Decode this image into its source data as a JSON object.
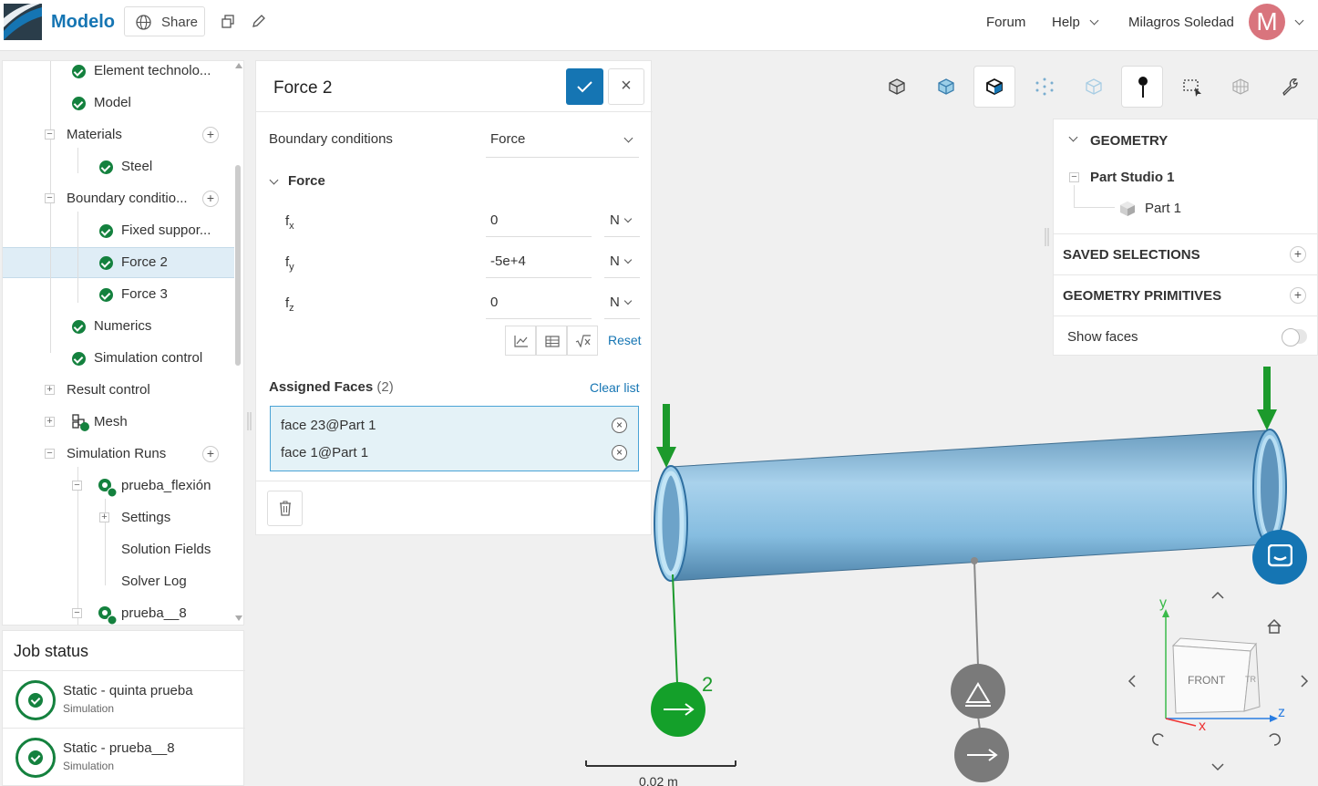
{
  "topbar": {
    "brand": "Modelo",
    "share_label": "Share",
    "forum_label": "Forum",
    "help_label": "Help",
    "user_name": "Milagros Soledad",
    "avatar_initial": "M"
  },
  "tree": {
    "items": [
      {
        "label": "Element technolo...",
        "status": "valid"
      },
      {
        "label": "Model",
        "status": "valid"
      },
      {
        "label": "Materials"
      },
      {
        "label": "Steel",
        "status": "valid"
      },
      {
        "label": "Boundary conditio..."
      },
      {
        "label": "Fixed suppor...",
        "status": "valid"
      },
      {
        "label": "Force 2",
        "status": "valid",
        "selected": true
      },
      {
        "label": "Force 3",
        "status": "valid"
      },
      {
        "label": "Numerics",
        "status": "valid"
      },
      {
        "label": "Simulation control",
        "status": "valid"
      },
      {
        "label": "Result control"
      },
      {
        "label": "Mesh",
        "status": "valid"
      },
      {
        "label": "Simulation Runs"
      },
      {
        "label": "prueba_flexión",
        "status": "valid"
      },
      {
        "label": "Settings"
      },
      {
        "label": "Solution Fields"
      },
      {
        "label": "Solver Log"
      },
      {
        "label": "prueba__8",
        "status": "valid"
      }
    ]
  },
  "job_status": {
    "title": "Job status",
    "jobs": [
      {
        "name": "Static - quinta prueba",
        "type": "Simulation",
        "status": "finished"
      },
      {
        "name": "Static - prueba__8",
        "type": "Simulation",
        "status": "finished"
      }
    ]
  },
  "force_panel": {
    "title": "Force 2",
    "boundary_label": "Boundary conditions",
    "boundary_value": "Force",
    "section_label": "Force",
    "components": [
      {
        "label": "f",
        "sub": "x",
        "value": "0",
        "unit": "N"
      },
      {
        "label": "f",
        "sub": "y",
        "value": "-5e+4",
        "unit": "N"
      },
      {
        "label": "f",
        "sub": "z",
        "value": "0",
        "unit": "N"
      }
    ],
    "reset_label": "Reset",
    "assigned_label": "Assigned Faces",
    "assigned_count": "(2)",
    "clear_label": "Clear list",
    "faces": [
      "face 23@Part 1",
      "face 1@Part 1"
    ]
  },
  "geometry_panel": {
    "title": "GEOMETRY",
    "studio": "Part Studio 1",
    "part": "Part 1",
    "saved_selections": "SAVED SELECTIONS",
    "primitives": "GEOMETRY PRIMITIVES",
    "show_faces": "Show faces",
    "show_faces_on": false
  },
  "viewport": {
    "force_count_label": "2",
    "scale_label": "0.02 m",
    "axes": {
      "x": "x",
      "y": "y",
      "z": "z"
    },
    "cube_front": "FRONT",
    "cube_side": "TR"
  },
  "colors": {
    "accent": "#1575b3",
    "valid": "#14813e",
    "selection_bg": "#dfedf6",
    "pipe": "#8fc3e3"
  }
}
